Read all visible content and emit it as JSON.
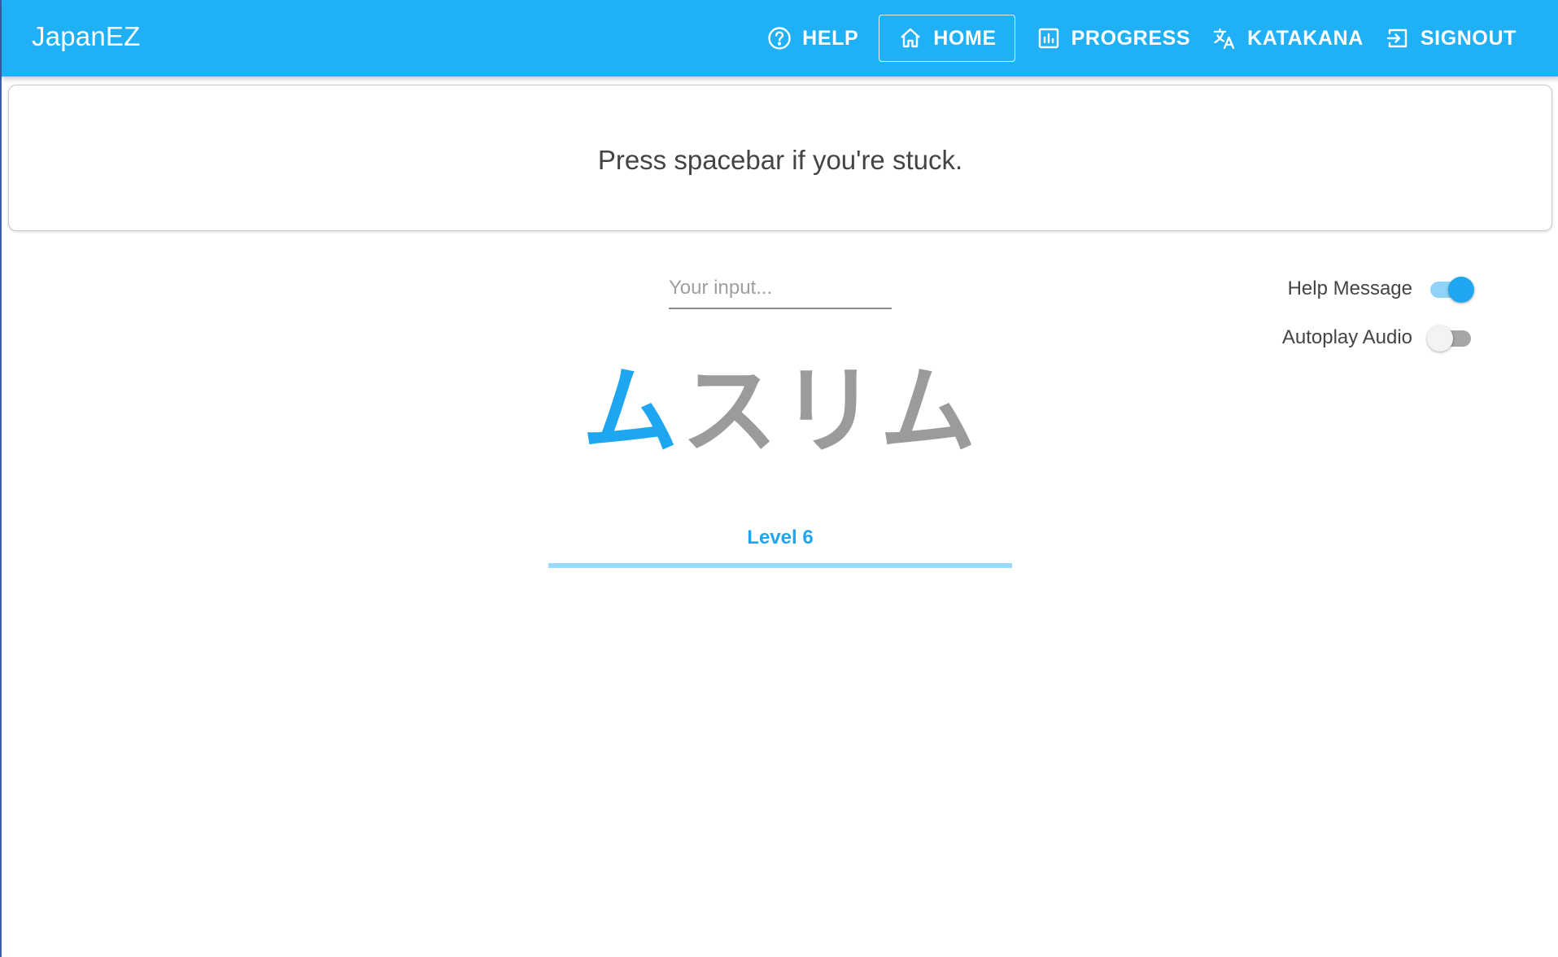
{
  "app": {
    "title": "JapanEZ"
  },
  "nav": {
    "items": [
      {
        "label": "HELP",
        "icon": "help-circle-icon",
        "active": false
      },
      {
        "label": "HOME",
        "icon": "home-icon",
        "active": true
      },
      {
        "label": "PROGRESS",
        "icon": "bar-chart-icon",
        "active": false
      },
      {
        "label": "KATAKANA",
        "icon": "translate-icon",
        "active": false
      },
      {
        "label": "SIGNOUT",
        "icon": "sign-out-icon",
        "active": false
      }
    ]
  },
  "hint": {
    "text": "Press spacebar if you're stuck."
  },
  "input": {
    "placeholder": "Your input...",
    "value": ""
  },
  "toggles": {
    "help_message": {
      "label": "Help Message",
      "on": true
    },
    "autoplay_audio": {
      "label": "Autoplay Audio",
      "on": false
    }
  },
  "word": {
    "characters": [
      {
        "char": "ム",
        "highlighted": true
      },
      {
        "char": "ス",
        "highlighted": false
      },
      {
        "char": "リ",
        "highlighted": false
      },
      {
        "char": "ム",
        "highlighted": false
      }
    ]
  },
  "level": {
    "label": "Level 6"
  },
  "colors": {
    "primary": "#1fb0f5",
    "accent": "#1fa6f0",
    "muted_char": "#9b9b9b"
  }
}
